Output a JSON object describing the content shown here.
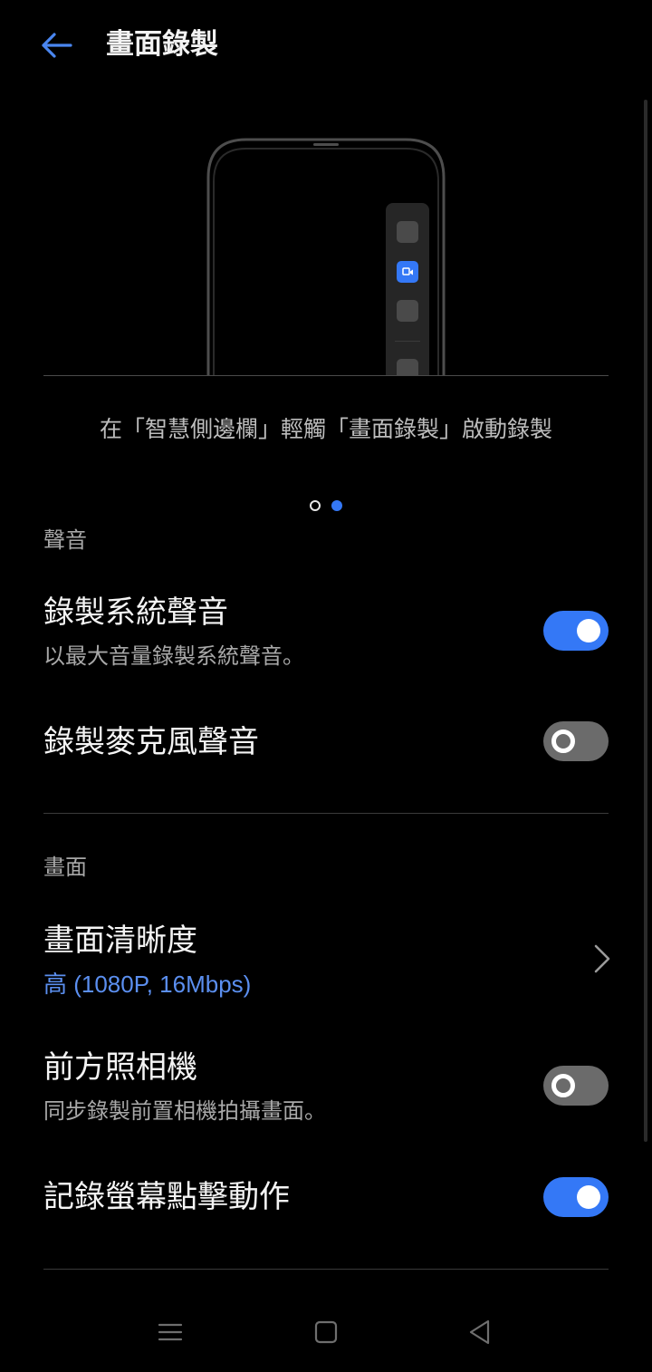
{
  "header": {
    "title": "畫面錄製",
    "back_icon": "back-arrow-icon"
  },
  "illustration": {
    "caption": "在「智慧側邊欄」輕觸「畫面錄製」啟動錄製",
    "pager_total": 2,
    "pager_active": 2
  },
  "sections": {
    "sound": {
      "header": "聲音",
      "record_system_sound": {
        "title": "錄製系統聲音",
        "subtitle": "以最大音量錄製系統聲音。",
        "enabled": true
      },
      "record_mic_sound": {
        "title": "錄製麥克風聲音",
        "enabled": false
      }
    },
    "screen": {
      "header": "畫面",
      "resolution": {
        "title": "畫面清晰度",
        "value": "高 (1080P, 16Mbps)"
      },
      "front_camera": {
        "title": "前方照相機",
        "subtitle": "同步錄製前置相機拍攝畫面。",
        "enabled": false
      },
      "record_touches": {
        "title": "記錄螢幕點擊動作",
        "enabled": true
      }
    }
  },
  "colors": {
    "accent": "#3478f6",
    "background": "#000000",
    "toggle_off": "#6b6b6b"
  },
  "nav_bar": {
    "icons": [
      "menu-icon",
      "home-icon",
      "back-triangle-icon"
    ]
  }
}
